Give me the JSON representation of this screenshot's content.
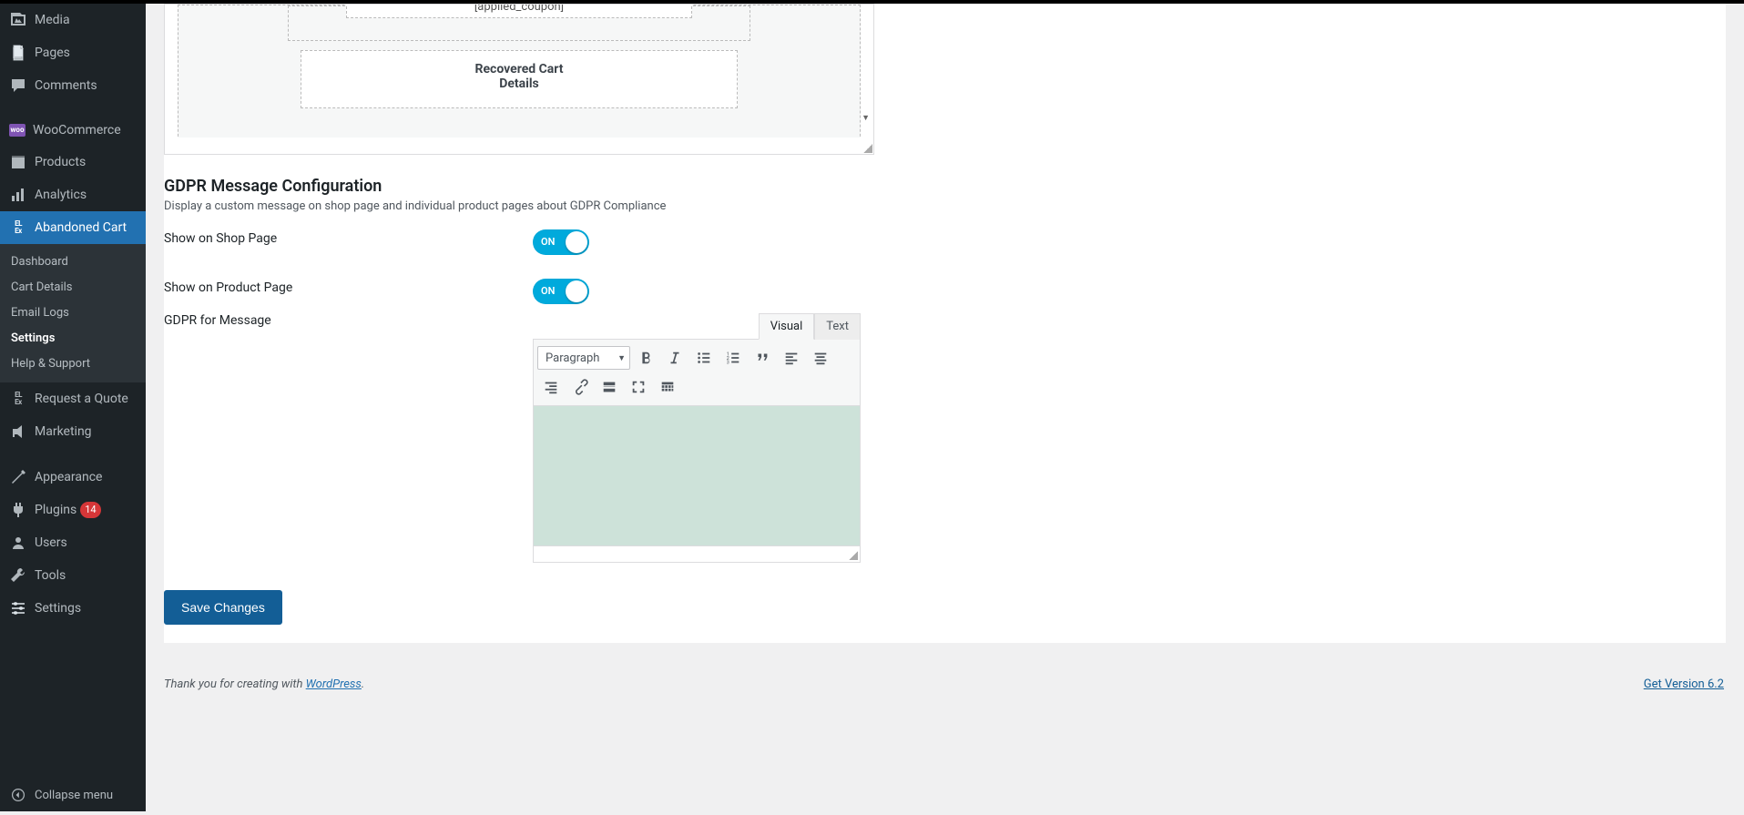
{
  "sidebar": {
    "top": [
      {
        "id": "media",
        "label": "Media",
        "icon": "media-icon"
      },
      {
        "id": "pages",
        "label": "Pages",
        "icon": "page-icon"
      },
      {
        "id": "comments",
        "label": "Comments",
        "icon": "comment-icon"
      }
    ],
    "mid": [
      {
        "id": "woocommerce",
        "label": "WooCommerce",
        "icon": "woo-icon"
      },
      {
        "id": "products",
        "label": "Products",
        "icon": "products-icon"
      },
      {
        "id": "analytics",
        "label": "Analytics",
        "icon": "analytics-icon"
      },
      {
        "id": "abandoned-cart",
        "label": "Abandoned Cart",
        "icon": "elex-icon",
        "current": true
      }
    ],
    "submenu": [
      {
        "id": "dashboard",
        "label": "Dashboard"
      },
      {
        "id": "cart-details",
        "label": "Cart Details"
      },
      {
        "id": "email-logs",
        "label": "Email Logs"
      },
      {
        "id": "settings",
        "label": "Settings",
        "active": true
      },
      {
        "id": "help",
        "label": "Help & Support"
      }
    ],
    "mid2": [
      {
        "id": "request-quote",
        "label": "Request a Quote",
        "icon": "elex-icon"
      },
      {
        "id": "marketing",
        "label": "Marketing",
        "icon": "megaphone-icon"
      }
    ],
    "bottom": [
      {
        "id": "appearance",
        "label": "Appearance",
        "icon": "appearance-icon"
      },
      {
        "id": "plugins",
        "label": "Plugins",
        "icon": "plugins-icon",
        "badge_count": "14"
      },
      {
        "id": "users",
        "label": "Users",
        "icon": "users-icon"
      },
      {
        "id": "tools",
        "label": "Tools",
        "icon": "tools-icon"
      },
      {
        "id": "settings",
        "label": "Settings",
        "icon": "settings-icon"
      }
    ],
    "collapse_label": "Collapse menu"
  },
  "top_editor": {
    "placeholder_line1": "Recovered Cart",
    "placeholder_line2": "Details"
  },
  "gdpr": {
    "heading": "GDPR Message Configuration",
    "description": "Display a custom message on shop page and individual product pages about GDPR Compliance",
    "show_shop_label": "Show on Shop Page",
    "show_shop_on_text": "ON",
    "show_product_label": "Show on Product Page",
    "show_product_on_text": "ON",
    "message_label": "GDPR for Message",
    "tabs": {
      "visual": "Visual",
      "text": "Text"
    },
    "paragraph_label": "Paragraph"
  },
  "buttons": {
    "save": "Save Changes"
  },
  "footer": {
    "thanks_prefix": "Thank you for creating with ",
    "wp_link": "WordPress",
    "thanks_suffix": ".",
    "version": "Get Version 6.2"
  }
}
